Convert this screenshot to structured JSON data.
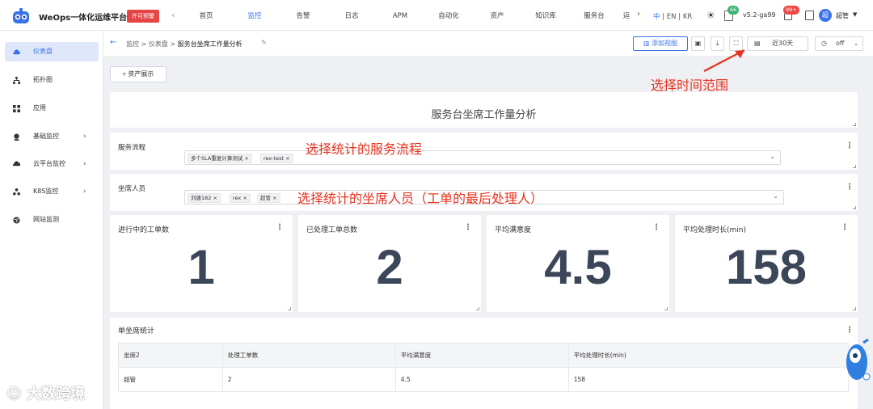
{
  "app": {
    "title": "WeOps一体化运维平台",
    "license_label": "许可预警",
    "version": "v5.2-ga99"
  },
  "nav": {
    "items": [
      "首页",
      "监控",
      "告警",
      "日志",
      "APM",
      "自动化",
      "资产",
      "知识库",
      "服务台",
      "运"
    ],
    "active_index": 1
  },
  "lang": {
    "zh": "中",
    "en": "EN",
    "kr": "KR"
  },
  "badges": {
    "notifications": "66",
    "alerts": "99+"
  },
  "user": {
    "name": "超管",
    "avatar_letter": "超"
  },
  "sidebar": {
    "items": [
      {
        "label": "仪表盘",
        "icon": "cloud-icon",
        "active": true,
        "expandable": false
      },
      {
        "label": "拓扑图",
        "icon": "topology-icon",
        "active": false,
        "expandable": false
      },
      {
        "label": "应用",
        "icon": "grid-icon",
        "active": false,
        "expandable": false
      },
      {
        "label": "基础监控",
        "icon": "monitor-icon",
        "active": false,
        "expandable": true
      },
      {
        "label": "云平台监控",
        "icon": "cloud-platform-icon",
        "active": false,
        "expandable": true
      },
      {
        "label": "K8S监控",
        "icon": "k8s-icon",
        "active": false,
        "expandable": true
      },
      {
        "label": "网站监测",
        "icon": "globe-icon",
        "active": false,
        "expandable": false
      }
    ]
  },
  "breadcrumb": {
    "items": [
      "监控",
      "仪表盘",
      "服务台坐席工作量分析"
    ]
  },
  "toolbar": {
    "add_view": "添加视图",
    "time_range": "近30天",
    "refresh": "off"
  },
  "asset_button": "资产展示",
  "annotations": {
    "time": "选择时间范围",
    "process": "选择统计的服务流程",
    "agent": "选择统计的坐席人员（工单的最后处理人）"
  },
  "dashboard": {
    "title": "服务台坐席工作量分析",
    "filters": [
      {
        "label": "服务流程",
        "tags": [
          "多个SLA重复计算测试",
          "rex-test"
        ]
      },
      {
        "label": "坐席人员",
        "tags": [
          "刘唐182",
          "rex",
          "超管"
        ]
      }
    ],
    "stats": [
      {
        "label": "进行中的工单数",
        "value": "1"
      },
      {
        "label": "已处理工单总数",
        "value": "2"
      },
      {
        "label": "平均满意度",
        "value": "4.5"
      },
      {
        "label": "平均处理时长(min)",
        "value": "158"
      }
    ],
    "table": {
      "title": "单坐席统计",
      "headers": [
        "坐席2",
        "处理工单数",
        "平均满意度",
        "平均处理时长(min)"
      ],
      "rows": [
        [
          "超管",
          "2",
          "4.5",
          "158"
        ]
      ]
    }
  },
  "watermark": "大数跨境",
  "colors": {
    "accent": "#3a72e8",
    "annotation": "#e8321f",
    "stat_value": "#3b4658"
  }
}
